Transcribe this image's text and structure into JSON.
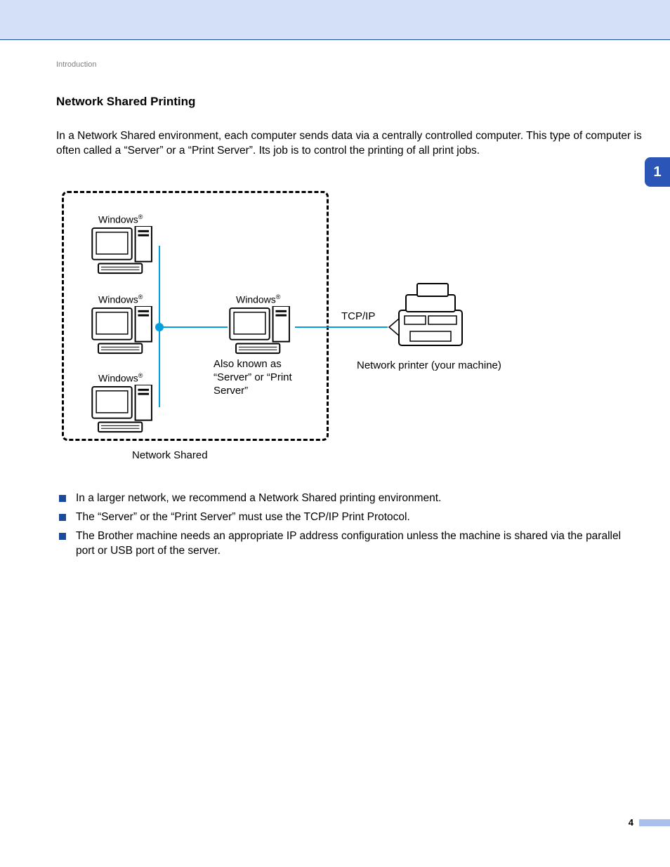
{
  "breadcrumb": "Introduction",
  "section_title": "Network Shared Printing",
  "intro_paragraph": "In a Network Shared environment, each computer sends data via a centrally controlled computer. This type of computer is often called a “Server” or a “Print Server”. Its job is to control the printing of all print jobs.",
  "chapter_number": "1",
  "diagram": {
    "pc_label": "Windows",
    "pc_label_sup": "®",
    "server_caption": "Also known as “Server” or “Print Server”",
    "network_shared": "Network Shared",
    "tcpip": "TCP/IP",
    "printer_caption": "Network printer (your machine)"
  },
  "bullets": [
    "In a larger network, we recommend a Network Shared printing environment.",
    "The “Server” or the “Print Server” must use the TCP/IP Print Protocol.",
    "The Brother machine needs an appropriate IP address configuration unless the machine is shared via the parallel port or USB port of the server."
  ],
  "page_number": "4"
}
